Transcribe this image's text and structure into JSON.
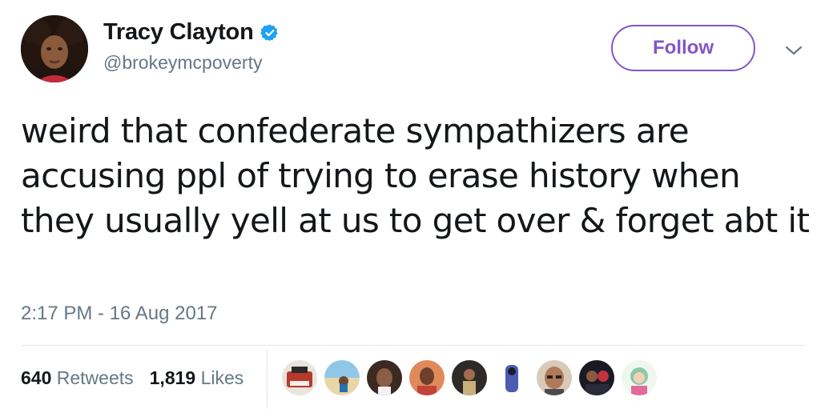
{
  "author": {
    "display_name": "Tracy Clayton",
    "handle": "@brokeymcpoverty",
    "verified_icon": "verified-badge-icon",
    "verified_color": "#1da1f2"
  },
  "follow_label": "Follow",
  "accent_color": "#8355c7",
  "tweet": {
    "text": "weird that confederate sympathizers are accusing ppl of trying to erase history when they usually yell at us to get over & forget abt it",
    "timestamp": "2:17 PM - 16 Aug 2017"
  },
  "stats": {
    "retweets_count": "640",
    "retweets_label": "Retweets",
    "likes_count": "1,819",
    "likes_label": "Likes"
  },
  "likers": [
    {
      "name": "typewriter",
      "color": "#b8392b"
    },
    {
      "name": "beach",
      "color": "#8fc7e8"
    },
    {
      "name": "woman-dark",
      "color": "#3a2a22"
    },
    {
      "name": "woman-red",
      "color": "#c0443a"
    },
    {
      "name": "concert",
      "color": "#2e2a28"
    },
    {
      "name": "figure-blue",
      "color": "#4a5db0"
    },
    {
      "name": "man-glasses",
      "color": "#b07a5a"
    },
    {
      "name": "group",
      "color": "#c23240"
    },
    {
      "name": "illustration",
      "color": "#8ec9a7"
    }
  ]
}
